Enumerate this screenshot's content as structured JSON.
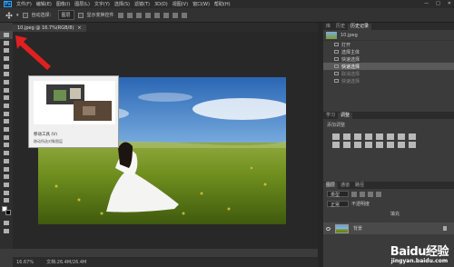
{
  "app": {
    "logo": "Ps"
  },
  "menu": [
    "文件(F)",
    "编辑(E)",
    "图像(I)",
    "图层(L)",
    "文字(Y)",
    "选择(S)",
    "滤镜(T)",
    "3D(D)",
    "视图(V)",
    "窗口(W)",
    "帮助(H)"
  ],
  "window_controls": [
    "—",
    "□",
    "✕"
  ],
  "options_bar": {
    "auto_select": "自动选择：",
    "layer_select": "图层",
    "show_transform": "显示变换控件"
  },
  "document": {
    "tab_title": "10.jpeg @ 16.7%(RGB/8)",
    "tab_close": "×"
  },
  "tooltip": {
    "title": "移动工具 (V)",
    "desc": "移动所选对象图层"
  },
  "status": {
    "zoom": "16.67%",
    "doc": "文档:26.4M/26.4M"
  },
  "history": {
    "tabs": [
      "库",
      "历史",
      "历史记录"
    ],
    "snapshot": "10.jpeg",
    "items": [
      {
        "label": "打开",
        "state": "normal"
      },
      {
        "label": "选择主体",
        "state": "normal"
      },
      {
        "label": "快速选择",
        "state": "normal"
      },
      {
        "label": "快速选择",
        "state": "selected"
      },
      {
        "label": "取消选择",
        "state": "dim"
      },
      {
        "label": "快速选择",
        "state": "dim"
      }
    ]
  },
  "adjustments": {
    "tabs": [
      "学习",
      "调整"
    ],
    "add_label": "添加调整"
  },
  "layers": {
    "tabs": [
      "图层",
      "通道",
      "路径"
    ],
    "kind": "类型",
    "blend": "正常",
    "opacity": "不透明度",
    "fill": "填充",
    "layer_name": "背景"
  },
  "watermark": {
    "logo": "Baidu经验",
    "url": "jingyan.baidu.com"
  },
  "colors": {
    "accent": "#31a8ff",
    "annotation_arrow": "#e02020"
  }
}
